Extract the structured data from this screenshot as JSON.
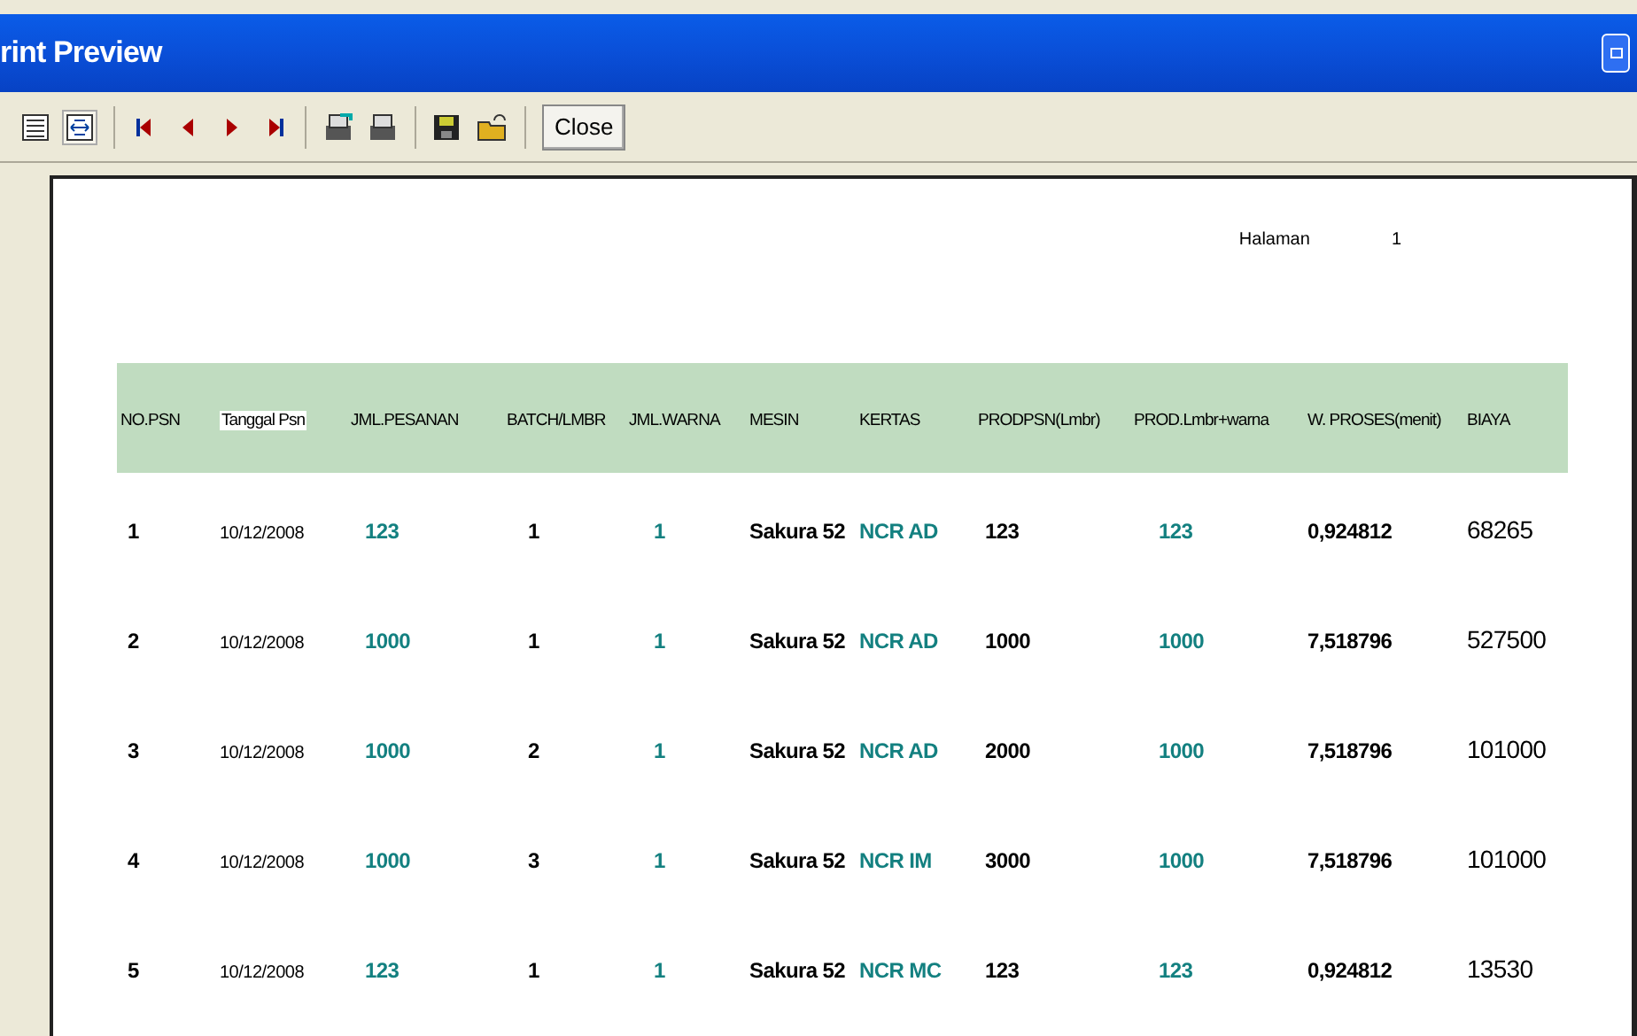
{
  "window": {
    "title": "rint Preview"
  },
  "toolbar": {
    "close_button": "Close"
  },
  "report": {
    "page_label": "Halaman",
    "page_number": "1",
    "table": {
      "columns": [
        "NO.PSN",
        "Tanggal Psn",
        "JML.PESANAN",
        "BATCH/LMBR",
        "JML.WARNA",
        "MESIN",
        "KERTAS",
        "PRODPSN(Lmbr)",
        "PROD.Lmbr+warna",
        "W. PROSES(menit)",
        "BIAYA"
      ],
      "rows": [
        [
          "1",
          "10/12/2008",
          "123",
          "1",
          "1",
          "Sakura 52",
          "NCR AD",
          "123",
          "123",
          "0,924812",
          "68265"
        ],
        [
          "2",
          "10/12/2008",
          "1000",
          "1",
          "1",
          "Sakura 52",
          "NCR AD",
          "1000",
          "1000",
          "7,518796",
          "527500"
        ],
        [
          "3",
          "10/12/2008",
          "1000",
          "2",
          "1",
          "Sakura 52",
          "NCR AD",
          "2000",
          "1000",
          "7,518796",
          "101000"
        ],
        [
          "4",
          "10/12/2008",
          "1000",
          "3",
          "1",
          "Sakura 52",
          "NCR IM",
          "3000",
          "1000",
          "7,518796",
          "101000"
        ],
        [
          "5",
          "10/12/2008",
          "123",
          "1",
          "1",
          "Sakura 52",
          "NCR MC",
          "123",
          "123",
          "0,924812",
          "13530"
        ]
      ]
    }
  }
}
